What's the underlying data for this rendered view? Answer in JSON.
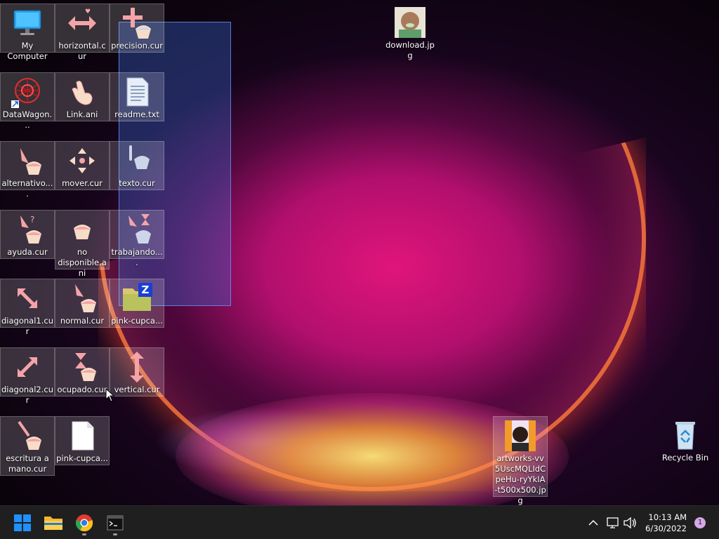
{
  "desktop": {
    "icons": [
      {
        "label": "My Computer",
        "icon": "monitor-icon"
      },
      {
        "label": "horizontal.cur",
        "icon": "cursor-horizontal-icon"
      },
      {
        "label": "precision.cur",
        "icon": "cursor-precision-icon"
      },
      {
        "label": "DataWagon...",
        "icon": "datawagon-shortcut-icon"
      },
      {
        "label": "Link.ani",
        "icon": "cursor-link-icon"
      },
      {
        "label": "readme.txt",
        "icon": "text-file-icon"
      },
      {
        "label": "alternativo....",
        "icon": "cursor-alternate-icon"
      },
      {
        "label": "mover.cur",
        "icon": "cursor-move-icon"
      },
      {
        "label": "texto.cur",
        "icon": "cursor-text-icon"
      },
      {
        "label": "ayuda.cur",
        "icon": "cursor-help-icon"
      },
      {
        "label": "no disponible.ani",
        "icon": "cursor-unavailable-icon"
      },
      {
        "label": "trabajando....",
        "icon": "cursor-working-icon"
      },
      {
        "label": "diagonal1.cur",
        "icon": "cursor-diagonal1-icon"
      },
      {
        "label": "normal.cur",
        "icon": "cursor-normal-icon"
      },
      {
        "label": "pink-cupca...",
        "icon": "zip-archive-icon"
      },
      {
        "label": "diagonal2.cur",
        "icon": "cursor-diagonal2-icon"
      },
      {
        "label": "ocupado.cur",
        "icon": "cursor-busy-icon"
      },
      {
        "label": "vertical.cur",
        "icon": "cursor-vertical-icon"
      },
      {
        "label": "escritura a mano.cur",
        "icon": "cursor-handwriting-icon"
      },
      {
        "label": "pink-cupca...",
        "icon": "blank-file-icon"
      },
      {
        "label": "download.jpg",
        "icon": "image-thumbnail-icon"
      },
      {
        "label": "artworks-vv5UscMQLIdCpeHu-ryYkIA-t500x500.jpg",
        "icon": "image-thumbnail-icon"
      },
      {
        "label": "Recycle Bin",
        "icon": "recycle-bin-icon"
      }
    ]
  },
  "taskbar": {
    "apps": [
      {
        "name": "start-button",
        "icon": "windows-logo-icon"
      },
      {
        "name": "file-explorer",
        "icon": "folder-icon"
      },
      {
        "name": "chrome",
        "icon": "chrome-icon"
      },
      {
        "name": "terminal",
        "icon": "terminal-icon"
      }
    ],
    "clock_time": "10:13 AM",
    "clock_date": "6/30/2022",
    "notification_count": "1"
  },
  "colors": {
    "selection": "#3c6edc",
    "taskbar": "#1f1f1f",
    "windows_blue": "#1e90ff",
    "cursor_pink": "#f4a4a8"
  }
}
